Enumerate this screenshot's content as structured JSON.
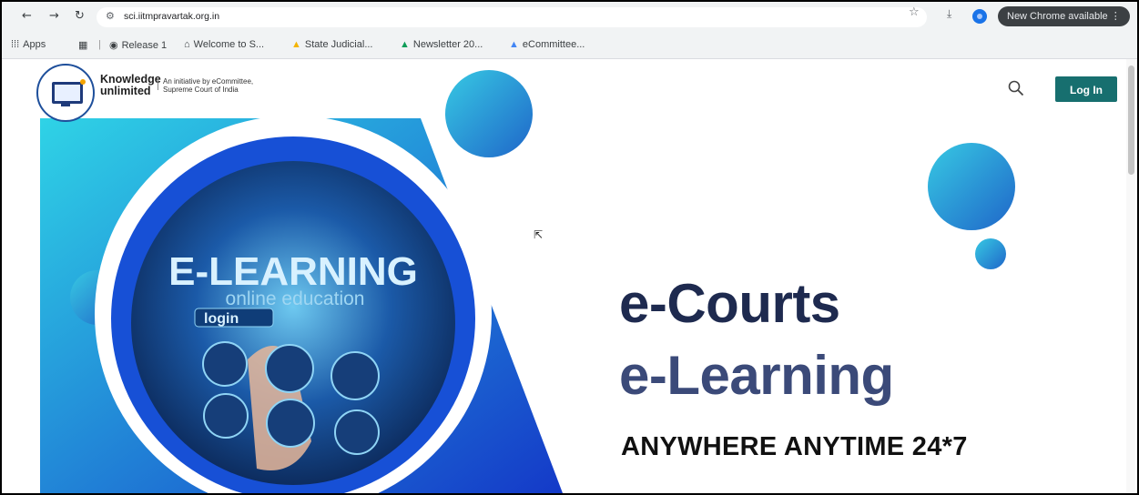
{
  "browser": {
    "url": "sci.iitmpravartak.org.in",
    "update_label": "New Chrome available",
    "update_menu": "⋮",
    "bookmarks": [
      {
        "label": "Apps"
      },
      {
        "label": "Release 1"
      },
      {
        "label": "Welcome to S..."
      },
      {
        "label": "State Judicial..."
      },
      {
        "label": "Newsletter 20..."
      },
      {
        "label": "eCommittee..."
      }
    ]
  },
  "header": {
    "brand_line1": "Knowledge",
    "brand_line2": "unlimited",
    "tagline_line1": "An initiative by eCommittee,",
    "tagline_line2": "Supreme Court of India",
    "login_label": "Log In"
  },
  "hero": {
    "banner_title": "E-LEARNING",
    "banner_subtitle": "online education",
    "banner_login": "login",
    "heading_line1": "e-Courts",
    "heading_line2": "e-Learning",
    "tagline": "ANYWHERE ANYTIME 24*7"
  },
  "colors": {
    "accent": "#176f6f",
    "hero_blue": "#1b4fd8",
    "hero_cyan": "#29c1e0",
    "heading_dark": "#1e2a4f"
  }
}
